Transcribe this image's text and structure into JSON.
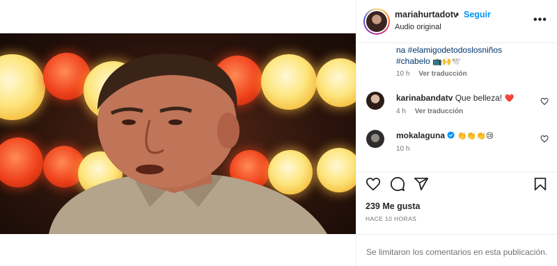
{
  "post": {
    "username": "mariahurtadotv",
    "dot": "•",
    "follow_label": "Seguir",
    "audio_label": "Audio original",
    "more_label": "•••"
  },
  "caption": {
    "line1": "na #elamigodetodoslosniños",
    "line2": "#chabelo",
    "line2_emojis": "📺🙌🕊️",
    "time": "10 h",
    "translate": "Ver traducción"
  },
  "comments": [
    {
      "user": "karinabandatv",
      "text": "Que belleza!",
      "emoji": "❤️",
      "time": "4 h",
      "translate": "Ver traducción"
    },
    {
      "user": "mokalaguna",
      "text": "",
      "emoji": "👏👏👏😢",
      "time": "10 h",
      "translate": ""
    }
  ],
  "likes_label": "239 Me gusta",
  "posted_ago": "HACE 10 HORAS",
  "comments_limited": "Se limitaron los comentarios en esta publicación.",
  "icons": {
    "like": "heart-icon",
    "comment": "comment-icon",
    "share": "share-icon",
    "save": "bookmark-icon",
    "mute": "speaker-icon",
    "verified": "verified-badge-icon"
  },
  "colors": {
    "accent": "#0095f6",
    "hashtag": "#00376b",
    "muted": "#737373",
    "heart": "#ed4956"
  }
}
